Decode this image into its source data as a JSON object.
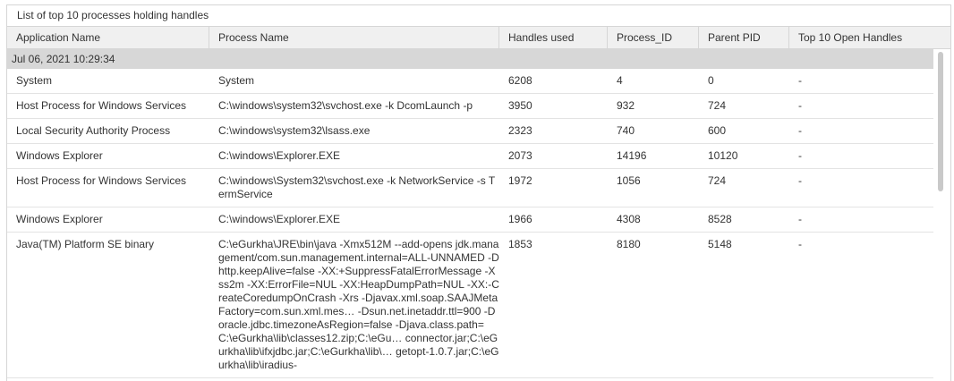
{
  "panel": {
    "title": "List of top 10 processes holding handles"
  },
  "columns": [
    "Application Name",
    "Process Name",
    "Handles used",
    "Process_ID",
    "Parent PID",
    "Top 10 Open Handles"
  ],
  "group": {
    "label": "Jul 06, 2021 10:29:34"
  },
  "rows": [
    {
      "app": "System",
      "process": "System",
      "handles": "6208",
      "pid": "4",
      "ppid": "0",
      "top": "-"
    },
    {
      "app": "Host Process for Windows Services",
      "process": "C:\\windows\\system32\\svchost.exe -k DcomLaunch -p",
      "handles": "3950",
      "pid": "932",
      "ppid": "724",
      "top": "-"
    },
    {
      "app": "Local Security Authority Process",
      "process": "C:\\windows\\system32\\lsass.exe",
      "handles": "2323",
      "pid": "740",
      "ppid": "600",
      "top": "-"
    },
    {
      "app": "Windows Explorer",
      "process": "C:\\windows\\Explorer.EXE",
      "handles": "2073",
      "pid": "14196",
      "ppid": "10120",
      "top": "-"
    },
    {
      "app": "Host Process for Windows Services",
      "process": "C:\\windows\\System32\\svchost.exe -k NetworkService -s TermService",
      "handles": "1972",
      "pid": "1056",
      "ppid": "724",
      "top": "-"
    },
    {
      "app": "Windows Explorer",
      "process": "C:\\windows\\Explorer.EXE",
      "handles": "1966",
      "pid": "4308",
      "ppid": "8528",
      "top": "-"
    },
    {
      "app": "Java(TM) Platform SE binary",
      "process": "C:\\eGurkha\\JRE\\bin\\java -Xmx512M --add-opens jdk.management/com.sun.management.internal=ALL-UNNAMED -Dhttp.keepAlive=false -XX:+SuppressFatalErrorMessage -Xss2m -XX:ErrorFile=NUL -XX:HeapDumpPath=NUL -XX:-CreateCoredumpOnCrash -Xrs -Djavax.xml.soap.SAAJMetaFactory=com.sun.xml.mes… -Dsun.net.inetaddr.ttl=900 -Doracle.jdbc.timezoneAsRegion=false -Djava.class.path=C:\\eGurkha\\lib\\classes12.zip;C:\\eGu… connector.jar;C:\\eGurkha\\lib\\ifxjdbc.jar;C:\\eGurkha\\lib\\… getopt-1.0.7.jar;C:\\eGurkha\\lib\\iradius-",
      "handles": "1853",
      "pid": "8180",
      "ppid": "5148",
      "top": "-"
    }
  ]
}
